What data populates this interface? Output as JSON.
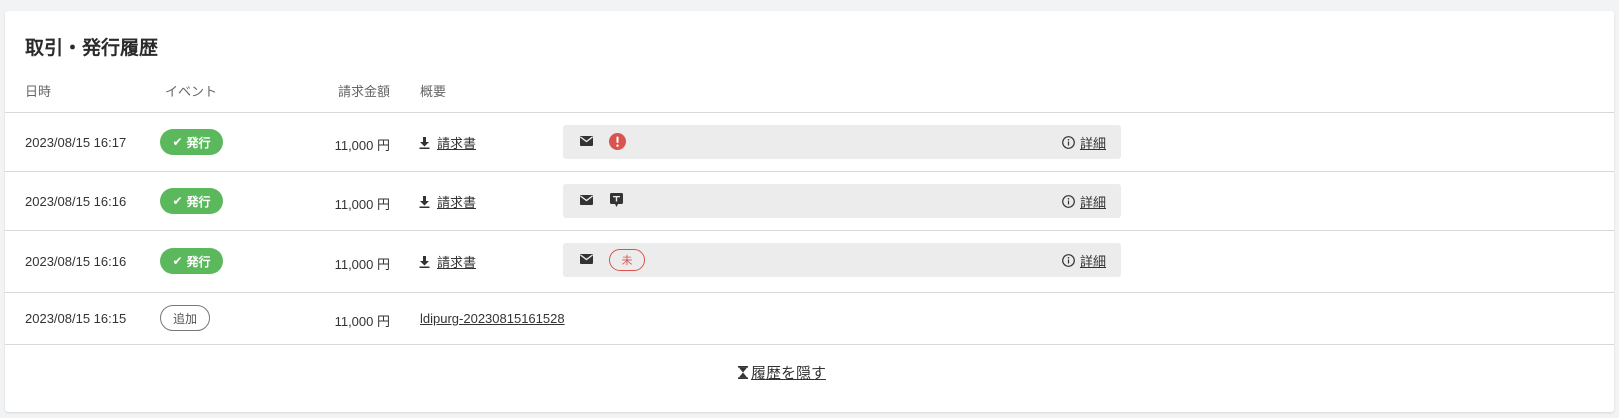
{
  "title": "取引・発行履歴",
  "columns": {
    "date": "日時",
    "event": "イベント",
    "amount": "請求金額",
    "summary": "概要"
  },
  "rows": [
    {
      "date": "2023/08/15 16:17",
      "event": "発行",
      "amount": "11,000 円",
      "document": "請求書",
      "status_icon": "error-icon",
      "detail": "詳細"
    },
    {
      "date": "2023/08/15 16:16",
      "event": "発行",
      "amount": "11,000 円",
      "document": "請求書",
      "status_icon": "message-icon",
      "detail": "詳細"
    },
    {
      "date": "2023/08/15 16:16",
      "event": "発行",
      "amount": "11,000 円",
      "document": "請求書",
      "status_label": "未",
      "detail": "詳細"
    },
    {
      "date": "2023/08/15 16:15",
      "event": "追加",
      "amount": "11,000 円",
      "reference": "ldipurg-20230815161528"
    }
  ],
  "hide_history": "履歴を隠す",
  "colors": {
    "success": "#5cb85c",
    "error": "#d9534f",
    "panel": "#ececec"
  }
}
